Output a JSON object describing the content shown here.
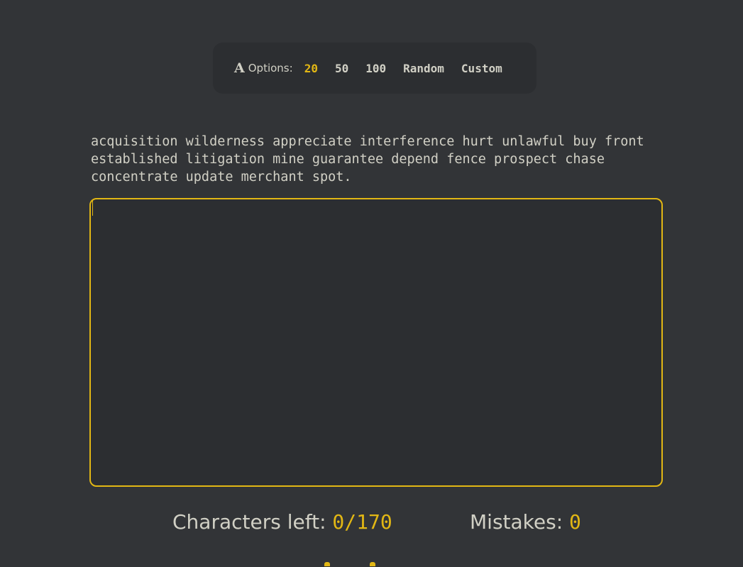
{
  "options": {
    "icon": "font-icon",
    "icon_glyph": "A",
    "label": "Options:",
    "items": [
      {
        "label": "20",
        "active": true
      },
      {
        "label": "50",
        "active": false
      },
      {
        "label": "100",
        "active": false
      },
      {
        "label": "Random",
        "active": false
      },
      {
        "label": "Custom",
        "active": false
      }
    ]
  },
  "prompt": {
    "text": "acquisition wilderness appreciate interference hurt unlawful buy front established litigation mine guarantee depend fence prospect chase concentrate update merchant spot."
  },
  "typing_area": {
    "value": ""
  },
  "stats": {
    "characters_left_label": "Characters left:",
    "characters_left_value": "0/170",
    "mistakes_label": "Mistakes:",
    "mistakes_value": "0"
  },
  "colors": {
    "background": "#323437",
    "panel": "#2c2e31",
    "text": "#d1d0c5",
    "accent": "#e2b714"
  }
}
